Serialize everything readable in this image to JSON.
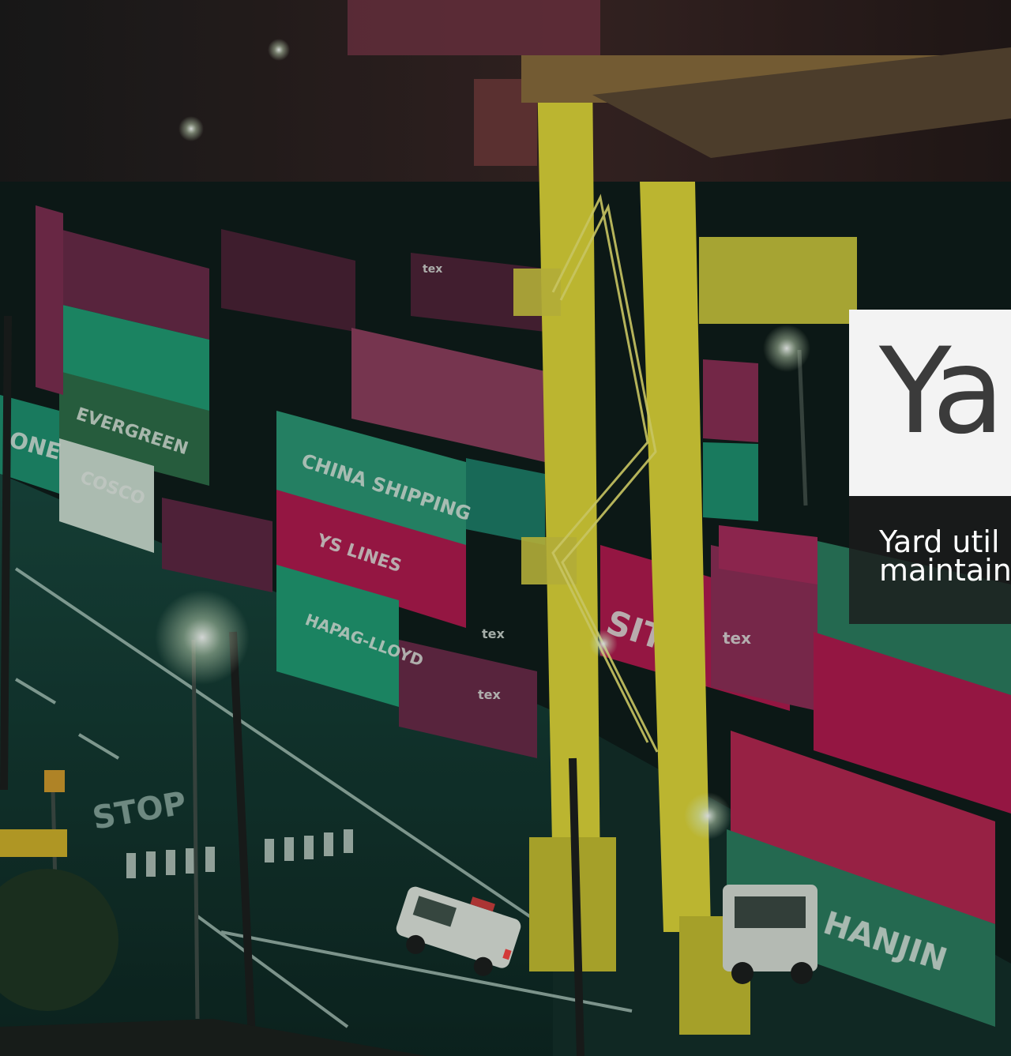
{
  "hero": {
    "title": "Yar",
    "subtitle_lines": [
      "Yard util",
      "maintain"
    ]
  },
  "scene": {
    "container_labels": [
      "ONE",
      "EVERGREEN",
      "COSCO",
      "CHINA SHIPPING",
      "YS LINES",
      "HAPAG-LLOYD",
      "tex",
      "tex",
      "tex",
      "tex",
      "SITC",
      "HANJIN",
      "STOP"
    ],
    "icons": [
      "gantry-crane-icon",
      "truck-icon",
      "pickup-truck-icon",
      "street-lamp-icon"
    ]
  },
  "colors": {
    "title_bg": "#f3f3f3",
    "title_text": "#3b3b3b",
    "subtitle_bg": "#1c1c1c",
    "subtitle_text": "#ffffff",
    "crane_yellow": "#e2d736",
    "container_green": "#1f9a72",
    "container_magenta": "#b2154c",
    "container_maroon": "#6a2746"
  }
}
